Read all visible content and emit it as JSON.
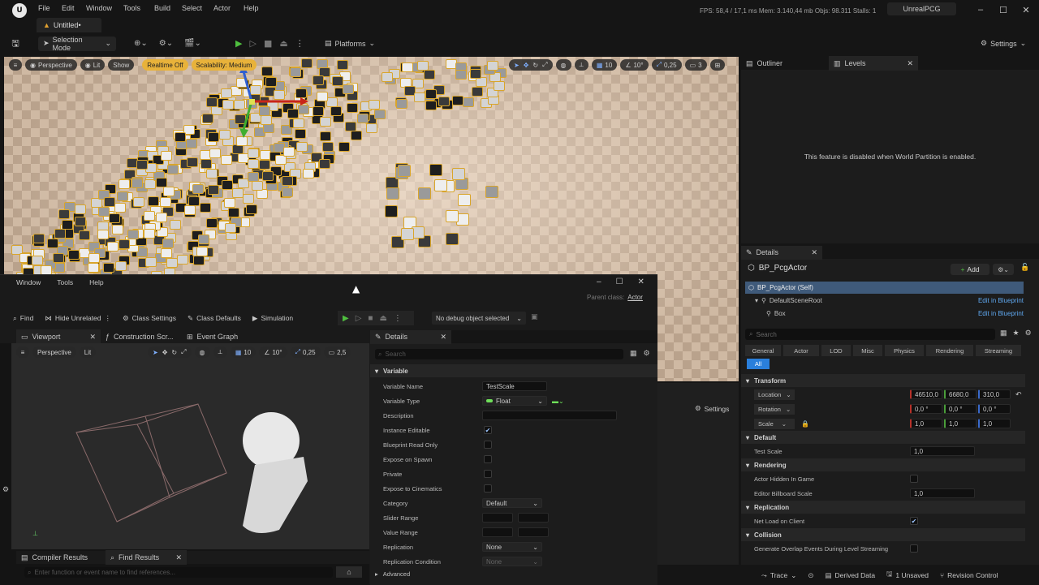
{
  "menu": [
    "File",
    "Edit",
    "Window",
    "Tools",
    "Build",
    "Select",
    "Actor",
    "Help"
  ],
  "doc_tab": "Untitled•",
  "stats": "FPS: 58,4  /  17,1 ms  Mem: 3.140,44 mb  Objs: 98.311  Stalls: 1",
  "project": "UnrealPCG",
  "toolbar": {
    "mode": "Selection Mode",
    "platforms": "Platforms",
    "settings": "Settings"
  },
  "viewport": {
    "perspective": "Perspective",
    "lit": "Lit",
    "show": "Show",
    "realtime": "Realtime Off",
    "scalability": "Scalability: Medium",
    "grid": "10",
    "angle": "10°",
    "scale": "0,25",
    "cam": "3"
  },
  "outliner": {
    "tab1": "Outliner",
    "tab2": "Levels",
    "message": "This feature is disabled when World Partition is enabled."
  },
  "details": {
    "tab": "Details",
    "actor": "BP_PcgActor",
    "add": "Add",
    "components": [
      {
        "name": "BP_PcgActor (Self)",
        "link": ""
      },
      {
        "name": "DefaultSceneRoot",
        "link": "Edit in Blueprint"
      },
      {
        "name": "Box",
        "link": "Edit in Blueprint"
      }
    ],
    "search": "Search",
    "filters": [
      "General",
      "Actor",
      "LOD",
      "Misc",
      "Physics",
      "Rendering",
      "Streaming"
    ],
    "all": "All",
    "transform": "Transform",
    "location": {
      "label": "Location",
      "x": "46510,0",
      "y": "6680,0",
      "z": "310,0"
    },
    "rotation": {
      "label": "Rotation",
      "x": "0,0 °",
      "y": "0,0 °",
      "z": "0,0 °"
    },
    "scale": {
      "label": "Scale",
      "x": "1,0",
      "y": "1,0",
      "z": "1,0"
    },
    "default": "Default",
    "test_scale_label": "Test Scale",
    "test_scale": "1,0",
    "rendering": "Rendering",
    "hidden_label": "Actor Hidden In Game",
    "billboard_label": "Editor Billboard Scale",
    "billboard": "1,0",
    "replication": "Replication",
    "net_load": "Net Load on Client",
    "collision": "Collision",
    "overlap": "Generate Overlap Events During Level Streaming"
  },
  "bp": {
    "menu": [
      "Window",
      "Tools",
      "Help"
    ],
    "parent_label": "Parent class:",
    "parent": "Actor",
    "tools": [
      "Find",
      "Hide Unrelated",
      "Class Settings",
      "Class Defaults",
      "Simulation"
    ],
    "debug": "No debug object selected",
    "tabs": [
      "Viewport",
      "Construction Scr...",
      "Event Graph"
    ],
    "vp_perspective": "Perspective",
    "vp_lit": "Lit",
    "vp_grid": "10",
    "vp_angle": "10°",
    "vp_scale": "0,25",
    "vp_cam": "2,5",
    "details_tab": "Details",
    "search": "Search",
    "variable": "Variable",
    "props": [
      {
        "label": "Variable Name",
        "value": "TestScale",
        "kind": "text"
      },
      {
        "label": "Variable Type",
        "value": "Float",
        "kind": "type"
      },
      {
        "label": "Description",
        "value": "",
        "kind": "wide"
      },
      {
        "label": "Instance Editable",
        "value": "✔",
        "kind": "check"
      },
      {
        "label": "Blueprint Read Only",
        "value": "",
        "kind": "check"
      },
      {
        "label": "Expose on Spawn",
        "value": "",
        "kind": "check"
      },
      {
        "label": "Private",
        "value": "",
        "kind": "check"
      },
      {
        "label": "Expose to Cinematics",
        "value": "",
        "kind": "check"
      },
      {
        "label": "Category",
        "value": "Default",
        "kind": "select"
      },
      {
        "label": "Slider Range",
        "value": "",
        "kind": "range"
      },
      {
        "label": "Value Range",
        "value": "",
        "kind": "range"
      },
      {
        "label": "Replication",
        "value": "None",
        "kind": "select2"
      },
      {
        "label": "Replication Condition",
        "value": "None",
        "kind": "select2d"
      }
    ],
    "advanced": "Advanced",
    "bottom_tabs": [
      "Compiler Results",
      "Find Results"
    ],
    "find_placeholder": "Enter function or event name to find references..."
  },
  "statusbar": {
    "trace": "Trace",
    "derived": "Derived Data",
    "unsaved": "1 Unsaved",
    "revision": "Revision Control"
  },
  "mid_settings": "Settings"
}
